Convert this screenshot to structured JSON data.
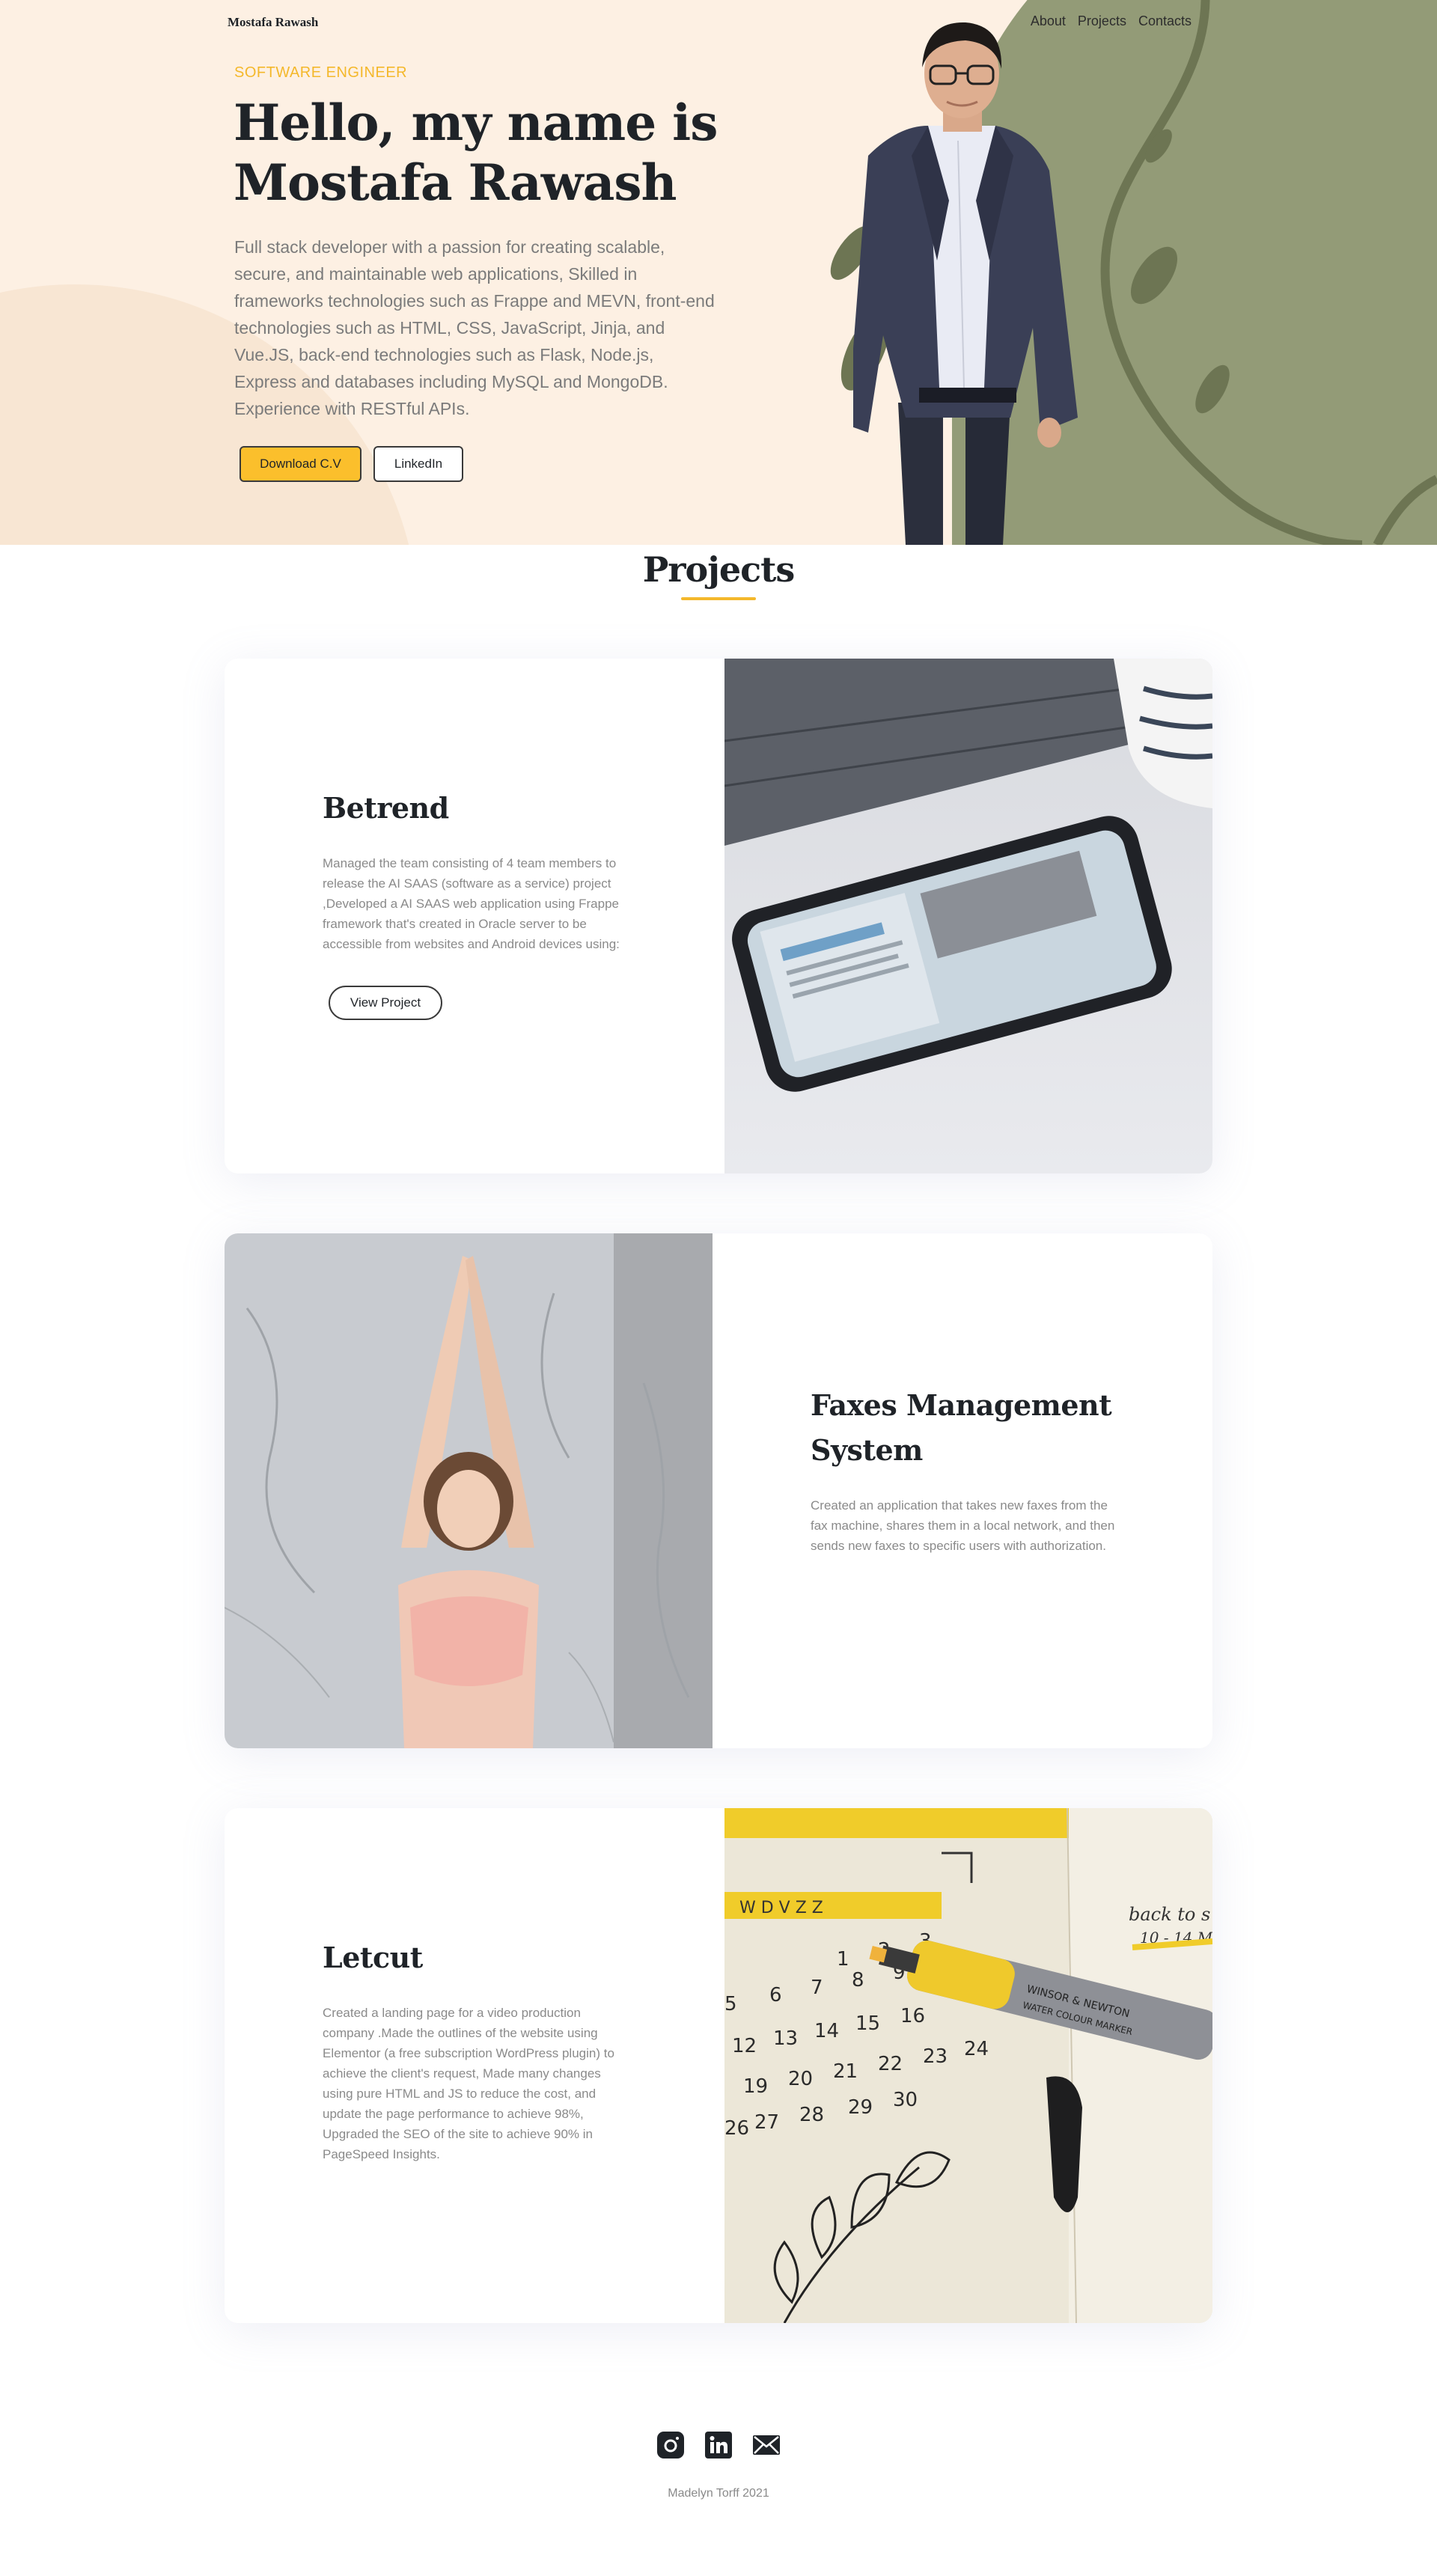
{
  "nav": {
    "brand": "Mostafa Rawash",
    "links": [
      "About",
      "Projects",
      "Contacts"
    ]
  },
  "hero": {
    "eyebrow": "SOFTWARE ENGINEER",
    "title_line1": "Hello, my name is",
    "title_line2": "Mostafa Rawash",
    "description": "Full stack developer with a passion for creating scalable, secure, and maintainable web applications, Skilled in frameworks technologies such as Frappe and MEVN, front-end technologies such as HTML, CSS, JavaScript, Jinja, and Vue.JS, back-end technologies such as Flask, Node.js, Express and databases including MySQL and MongoDB. Experience with RESTful APIs.",
    "download_label": "Download C.V",
    "linkedin_label": "LinkedIn"
  },
  "projects": {
    "heading": "Projects",
    "items": [
      {
        "title": "Betrend",
        "description": "Managed the team consisting of 4 team members to release the AI SAAS (software as a service) project ,Developed a AI SAAS web application using Frappe framework that's created in Oracle server to be accessible from websites and Android devices using:",
        "button": "View Project"
      },
      {
        "title": "Faxes Management System",
        "description": "Created an application that takes new faxes from the fax machine, shares them in a local network, and then sends new faxes to specific users with authorization."
      },
      {
        "title": "Letcut",
        "description": "Created a landing page for a video production company .Made the outlines of the website using Elementor (a free subscription WordPress plugin) to achieve the client's request, Made many changes using pure HTML and JS to reduce the cost, and update the page performance to achieve 98%, Upgraded the SEO of the site to achieve 90% in PageSpeed Insights."
      }
    ]
  },
  "calendar": {
    "weekdays": "W D V Z Z",
    "note_line1": "back to s",
    "note_line2": "10 - 14 M",
    "rows": [
      [
        "1",
        "2",
        "3"
      ],
      [
        "5",
        "6",
        "7",
        "8",
        "9"
      ],
      [
        "12",
        "13",
        "14",
        "15",
        "16"
      ],
      [
        "19",
        "20",
        "21",
        "22",
        "23",
        "24"
      ],
      [
        "26",
        "27",
        "28",
        "29",
        "30"
      ]
    ],
    "marker_brand": "WINSOR & NEWTON",
    "marker_label": "WATER COLOUR MARKER"
  },
  "footer": {
    "icons": [
      "instagram-icon",
      "linkedin-icon",
      "mail-icon"
    ],
    "copyright": "Madelyn Torff 2021"
  },
  "colors": {
    "accent": "#fbbf2c",
    "hero_bg": "#fdf0e3",
    "olive": "#939b77",
    "text_dark": "#1f2328",
    "text_muted": "#8a8a8a"
  }
}
